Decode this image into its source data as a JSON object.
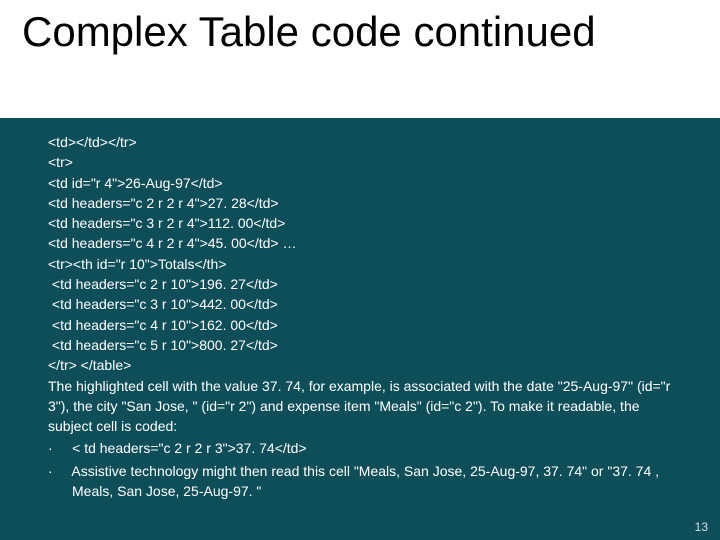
{
  "title": "Complex Table code continued",
  "code_lines": [
    "<td></td></tr>",
    "<tr>",
    "<td id=\"r 4\">26-Aug-97</td>",
    "<td headers=\"c 2 r 2 r 4\">27. 28</td>",
    "<td headers=\"c 3 r 2 r 4\">112. 00</td>",
    "<td headers=\"c 4 r 2 r 4\">45. 00</td> …",
    "<tr><th id=\"r 10\">Totals</th>",
    " <td headers=\"c 2 r 10\">196. 27</td>",
    " <td headers=\"c 3 r 10\">442. 00</td>",
    " <td headers=\"c 4 r 10\">162. 00</td>",
    " <td headers=\"c 5 r 10\">800. 27</td>",
    "</tr> </table>"
  ],
  "paragraph": "The highlighted cell with the value 37. 74, for example, is associated with the date \"25-Aug-97\" (id=\"r 3\"), the city \"San Jose, \" (id=\"r 2\") and expense item \"Meals\" (id=\"c 2\"). To make it readable, the subject cell is coded:",
  "bullets": [
    "< td headers=\"c 2 r 2 r 3\">37. 74</td>",
    "Assistive technology might then read this cell \"Meals, San Jose, 25-Aug-97, 37. 74\" or \"37. 74 , Meals, San Jose, 25-Aug-97. \""
  ],
  "page_number": "13",
  "bullet_marker": "·"
}
